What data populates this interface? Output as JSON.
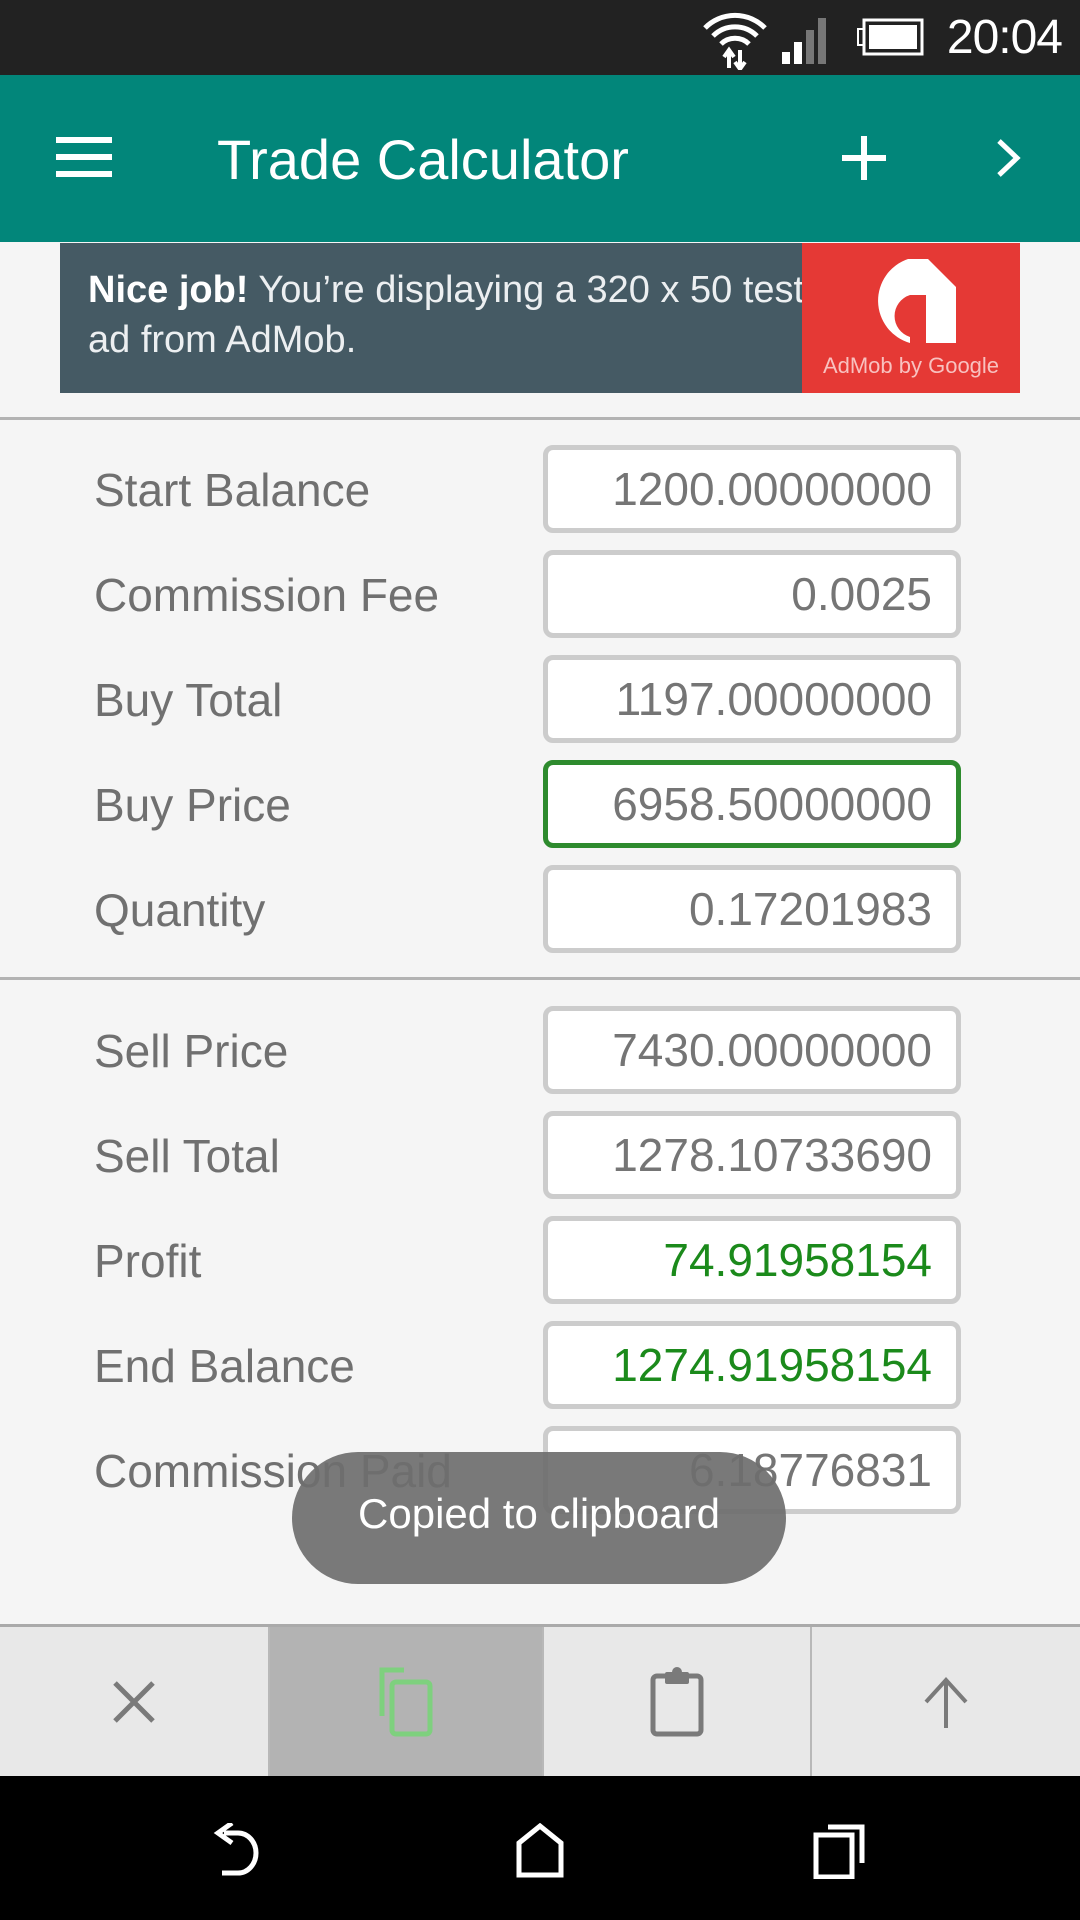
{
  "status_bar": {
    "time": "20:04",
    "icons": [
      "wifi-data-icon",
      "cell-signal-icon",
      "battery-icon"
    ]
  },
  "app_bar": {
    "title": "Trade Calculator",
    "menu_icon": "hamburger-menu-icon",
    "actions": [
      {
        "name": "add",
        "icon": "plus-icon"
      },
      {
        "name": "next",
        "icon": "chevron-right-icon"
      }
    ]
  },
  "ad": {
    "bold": "Nice job!",
    "text": " You’re displaying a 320 x 50 test ad from AdMob.",
    "brand": "AdMob by Google",
    "brand_color": "#e53935"
  },
  "buy_section": [
    {
      "label": "Start Balance",
      "value": "1200.00000000"
    },
    {
      "label": "Commission Fee",
      "value": "0.0025"
    },
    {
      "label": "Buy Total",
      "value": "1197.00000000"
    },
    {
      "label": "Buy Price",
      "value": "6958.50000000",
      "focused": true
    },
    {
      "label": "Quantity",
      "value": "0.17201983"
    }
  ],
  "sell_section": [
    {
      "label": "Sell Price",
      "value": "7430.00000000"
    },
    {
      "label": "Sell Total",
      "value": "1278.10733690"
    },
    {
      "label": "Profit",
      "value": "74.91958154",
      "positive": true
    },
    {
      "label": "End Balance",
      "value": "1274.91958154",
      "positive": true
    },
    {
      "label": "Commission Paid",
      "value": "6.18776831"
    }
  ],
  "toast": {
    "message": "Copied to clipboard"
  },
  "toolbar": {
    "buttons": [
      {
        "name": "clear",
        "icon": "close-icon"
      },
      {
        "name": "copy",
        "icon": "copy-icon",
        "active": true
      },
      {
        "name": "paste",
        "icon": "clipboard-icon"
      },
      {
        "name": "share",
        "icon": "arrow-up-icon"
      }
    ]
  },
  "colors": {
    "app_bar": "#02867a",
    "focused_border": "#2e8b2e",
    "positive_value": "#1b8a1b",
    "copy_icon": "#7ed07e"
  },
  "nav_bar": {
    "buttons": [
      "back-icon",
      "home-icon",
      "recents-icon"
    ]
  }
}
